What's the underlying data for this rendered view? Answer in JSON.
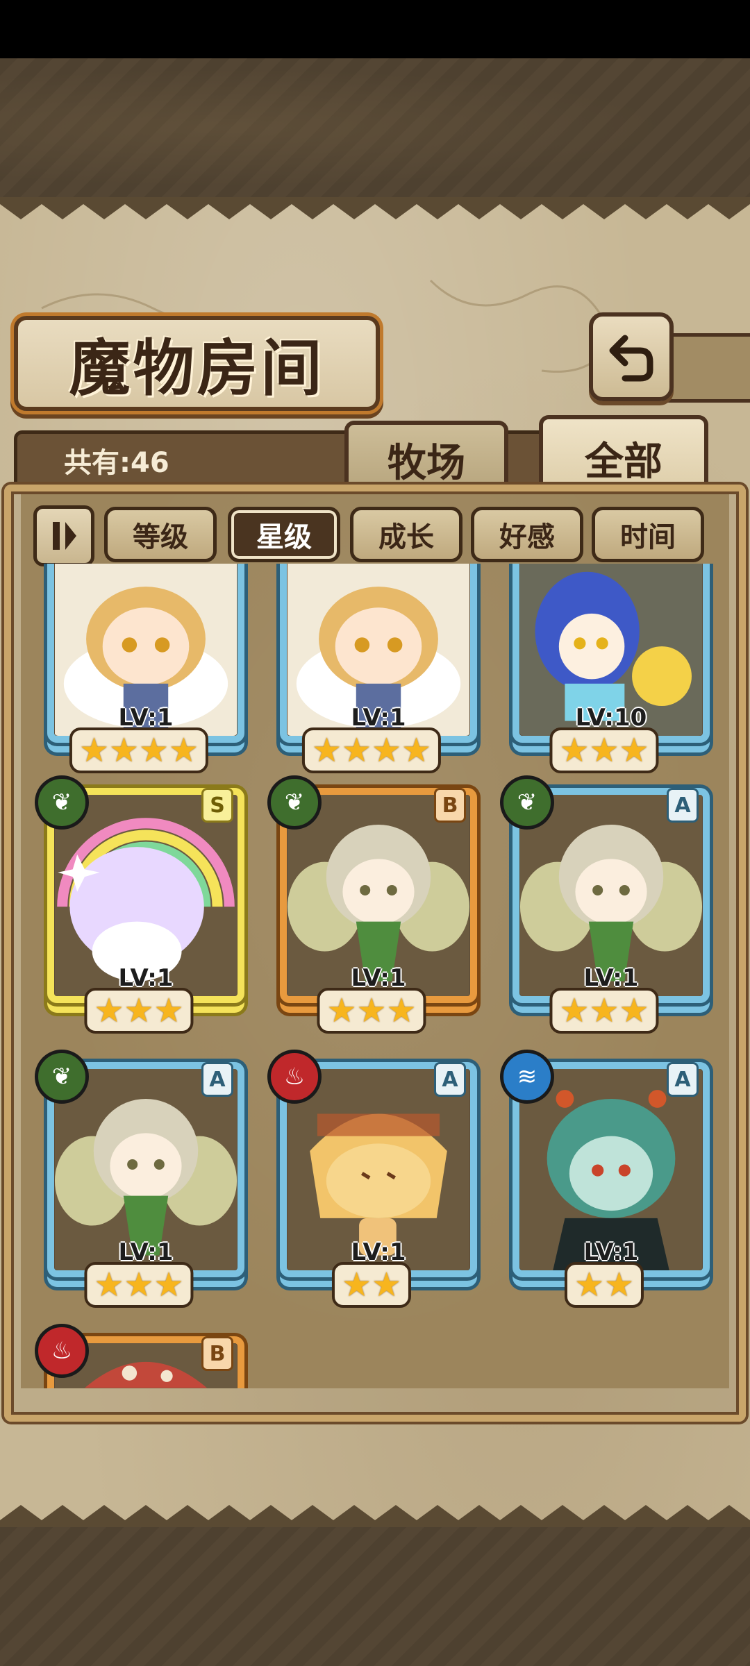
{
  "screen": {
    "title": "魔物房间",
    "count_label": "共有:46"
  },
  "tabs": [
    {
      "label": "牧场",
      "active": false
    },
    {
      "label": "全部",
      "active": true
    }
  ],
  "sort": {
    "toggle_icon": "pause-icon",
    "buttons": [
      {
        "label": "等级",
        "active": false
      },
      {
        "label": "星级",
        "active": true
      },
      {
        "label": "成长",
        "active": false
      },
      {
        "label": "好感",
        "active": false
      },
      {
        "label": "时间",
        "active": false
      }
    ]
  },
  "monsters": [
    {
      "level": "LV:1",
      "stars": "★★★★",
      "element": "",
      "rank": "",
      "frame": "blue",
      "art": "angel"
    },
    {
      "level": "LV:1",
      "stars": "★★★★",
      "element": "",
      "rank": "",
      "frame": "blue",
      "art": "angel"
    },
    {
      "level": "LV:10",
      "stars": "★★★",
      "element": "",
      "rank": "",
      "frame": "blue",
      "art": "catgirl"
    },
    {
      "level": "LV:1",
      "stars": "★★★",
      "element": "wood",
      "rank": "S",
      "frame": "gold",
      "art": "rainbow"
    },
    {
      "level": "LV:1",
      "stars": "★★★",
      "element": "wood",
      "rank": "B",
      "frame": "orange",
      "art": "fairy"
    },
    {
      "level": "LV:1",
      "stars": "★★★",
      "element": "wood",
      "rank": "A",
      "frame": "blue",
      "art": "fairy"
    },
    {
      "level": "LV:1",
      "stars": "★★★",
      "element": "wood",
      "rank": "A",
      "frame": "blue",
      "art": "fairy"
    },
    {
      "level": "LV:1",
      "stars": "★★",
      "element": "fire",
      "rank": "A",
      "frame": "blue",
      "art": "pudding"
    },
    {
      "level": "LV:1",
      "stars": "★★",
      "element": "water",
      "rank": "A",
      "frame": "blue",
      "art": "kappa"
    },
    {
      "level": "",
      "stars": "",
      "element": "fire",
      "rank": "B",
      "frame": "orange",
      "art": "mushroom"
    }
  ]
}
